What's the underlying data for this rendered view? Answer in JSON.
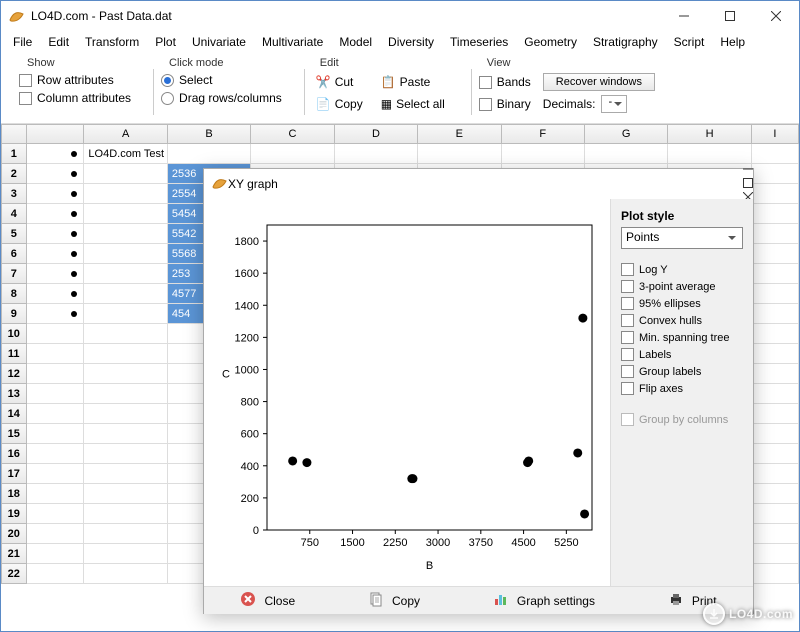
{
  "window": {
    "title": "LO4D.com - Past Data.dat"
  },
  "menubar": [
    "File",
    "Edit",
    "Transform",
    "Plot",
    "Univariate",
    "Multivariate",
    "Model",
    "Diversity",
    "Timeseries",
    "Geometry",
    "Stratigraphy",
    "Script",
    "Help"
  ],
  "ribbon": {
    "show": {
      "label": "Show",
      "row_attributes": "Row attributes",
      "column_attributes": "Column attributes"
    },
    "click_mode": {
      "label": "Click mode",
      "select": "Select",
      "drag": "Drag rows/columns",
      "selected": "select"
    },
    "edit": {
      "label": "Edit",
      "cut": "Cut",
      "copy": "Copy",
      "paste": "Paste",
      "select_all": "Select all"
    },
    "view": {
      "label": "View",
      "bands": "Bands",
      "binary": "Binary",
      "recover": "Recover windows",
      "decimals_label": "Decimals:",
      "decimals_value": "-"
    }
  },
  "grid": {
    "columns": [
      "",
      "",
      "A",
      "B",
      "C",
      "D",
      "E",
      "F",
      "G",
      "H",
      "I"
    ],
    "rows": [
      {
        "num": "1",
        "a": "LO4D.com Test",
        "b": ""
      },
      {
        "num": "2",
        "a": "",
        "b": "2536"
      },
      {
        "num": "3",
        "a": "",
        "b": "2554"
      },
      {
        "num": "4",
        "a": "",
        "b": "5454"
      },
      {
        "num": "5",
        "a": "",
        "b": "5542"
      },
      {
        "num": "6",
        "a": "",
        "b": "5568"
      },
      {
        "num": "7",
        "a": "",
        "b": "253"
      },
      {
        "num": "8",
        "a": "",
        "b": "4577"
      },
      {
        "num": "9",
        "a": "",
        "b": "454"
      }
    ],
    "empty_rows": [
      "10",
      "11",
      "12",
      "13",
      "14",
      "15",
      "16",
      "17",
      "18",
      "19",
      "20",
      "21",
      "22"
    ]
  },
  "xy_window": {
    "title": "XY graph",
    "plot_style_label": "Plot style",
    "plot_style_value": "Points",
    "options": [
      "Log Y",
      "3-point average",
      "95% ellipses",
      "Convex hulls",
      "Min. spanning tree",
      "Labels",
      "Group labels",
      "Flip axes"
    ],
    "group_by_columns": "Group by columns",
    "toolbar": {
      "close": "Close",
      "copy": "Copy",
      "graph_settings": "Graph settings",
      "print": "Print"
    }
  },
  "chart_data": {
    "type": "scatter",
    "xlabel": "B",
    "ylabel": "C",
    "xlim": [
      0,
      5700
    ],
    "ylim": [
      0,
      1900
    ],
    "xticks": [
      750,
      1500,
      2250,
      3000,
      3750,
      4500,
      5250
    ],
    "yticks": [
      0,
      200,
      400,
      600,
      800,
      1000,
      1200,
      1400,
      1600,
      1800
    ],
    "points": [
      {
        "x": 450,
        "y": 430
      },
      {
        "x": 700,
        "y": 420
      },
      {
        "x": 2540,
        "y": 320
      },
      {
        "x": 2560,
        "y": 320
      },
      {
        "x": 4570,
        "y": 420
      },
      {
        "x": 4590,
        "y": 430
      },
      {
        "x": 5450,
        "y": 480
      },
      {
        "x": 5540,
        "y": 1320
      },
      {
        "x": 5570,
        "y": 100
      }
    ]
  },
  "watermark": "LO4D.com"
}
